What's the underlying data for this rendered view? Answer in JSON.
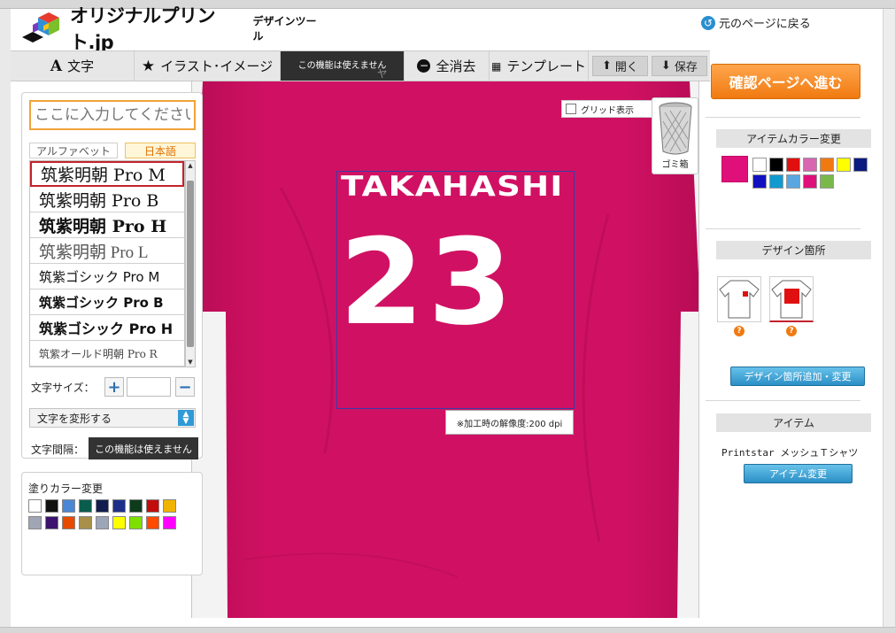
{
  "header": {
    "logo_text": "オリジナルプリント.jp",
    "logo_sub": "デザインツール",
    "back_link": "元のページに戻る"
  },
  "toolbar": {
    "text_tab": "文字",
    "illust_tab": "イラスト･イメージ",
    "disabled_notice": "この機能は使えません",
    "disabled_under": "ャ",
    "clear_all": "全消去",
    "template": "テンプレート",
    "open": "開く",
    "save": "保存"
  },
  "text_panel": {
    "input_placeholder": "ここに入力してください",
    "tab_alphabet": "アルファベット",
    "tab_japanese": "日本語",
    "fonts": [
      "筑紫明朝 Pro M",
      "筑紫明朝 Pro B",
      "筑紫明朝 Pro H",
      "筑紫明朝 Pro L",
      "筑紫ゴシック Pro M",
      "筑紫ゴシック Pro B",
      "筑紫ゴシック Pro H",
      "筑紫オールド明朝 Pro R"
    ],
    "size_label": "文字サイズ：",
    "size_plus": "+",
    "size_minus": "−",
    "transform_label": "文字を変形する",
    "spacing_label": "文字間隔：",
    "spacing_disabled": "この機能は使えません"
  },
  "fill_panel": {
    "title": "塗りカラー変更",
    "colors": [
      "#ffffff",
      "#111111",
      "#4a86d6",
      "#0a5d4c",
      "#101d4e",
      "#1d2f8a",
      "#0e3b1c",
      "#c20c0c",
      "#f0b400",
      "#a0a6b4",
      "#3b126e",
      "#e84a00",
      "#a8904a",
      "#9ca6b8",
      "#ffff00",
      "#7ee000",
      "#ff4a00",
      "#ff00ff"
    ]
  },
  "canvas": {
    "grid_label": "グリッド表示",
    "trash_label": "ゴミ箱",
    "name_text": "TAKAHASHI",
    "number_text": "23",
    "resolution_note": "※加工時の解像度:200 dpi",
    "shirt_color": "#cc1060"
  },
  "right_panel": {
    "cta": "確認ページへ進む",
    "item_color_title": "アイテムカラー変更",
    "selected_color": "#e0107a",
    "item_colors": [
      "#ffffff",
      "#000000",
      "#e01010",
      "#d866b0",
      "#f07a10",
      "#ffff00",
      "#0a1a80",
      "#1010c0",
      "#109ad0",
      "#5aa6e0",
      "#e0107a",
      "#7ab84a"
    ],
    "design_area_title": "デザイン箇所",
    "design_area_btn": "デザイン箇所追加・変更",
    "item_title": "アイテム",
    "item_name": "Printstar メッシュＴシャツ",
    "item_change_btn": "アイテム変更",
    "help_mark": "?"
  }
}
